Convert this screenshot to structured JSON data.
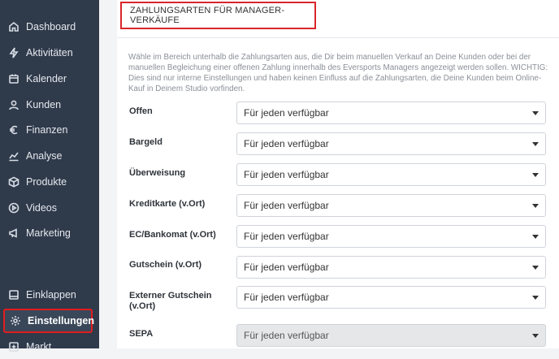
{
  "sidebar": {
    "items": [
      {
        "label": "Dashboard",
        "icon": "home-icon"
      },
      {
        "label": "Aktivitäten",
        "icon": "lightning-icon"
      },
      {
        "label": "Kalender",
        "icon": "calendar-icon"
      },
      {
        "label": "Kunden",
        "icon": "user-icon"
      },
      {
        "label": "Finanzen",
        "icon": "euro-icon"
      },
      {
        "label": "Analyse",
        "icon": "chart-line-icon"
      },
      {
        "label": "Produkte",
        "icon": "box-icon"
      },
      {
        "label": "Videos",
        "icon": "play-circle-icon"
      },
      {
        "label": "Marketing",
        "icon": "megaphone-icon"
      }
    ],
    "collapse_label": "Einklappen",
    "settings_label": "Einstellungen",
    "market_label": "Markt"
  },
  "panel": {
    "title": "ZAHLUNGSARTEN FÜR MANAGER-VERKÄUFE",
    "description": "Wähle im Bereich unterhalb die Zahlungsarten aus, die Dir beim manuellen Verkauf an Deine Kunden oder bei der manuellen Begleichung einer offenen Zahlung innerhalb des Eversports Managers angezeigt werden sollen. WICHTIG: Dies sind nur interne Einstellungen und haben keinen Einfluss auf die Zahlungsarten, die Deine Kunden beim Online-Kauf in Deinem Studio vorfinden.",
    "rows": [
      {
        "label": "Offen",
        "value": "Für jeden verfügbar"
      },
      {
        "label": "Bargeld",
        "value": "Für jeden verfügbar"
      },
      {
        "label": "Überweisung",
        "value": "Für jeden verfügbar"
      },
      {
        "label": "Kreditkarte (v.Ort)",
        "value": "Für jeden verfügbar"
      },
      {
        "label": "EC/Bankomat (v.Ort)",
        "value": "Für jeden verfügbar"
      },
      {
        "label": "Gutschein (v.Ort)",
        "value": "Für jeden verfügbar"
      },
      {
        "label": "Externer Gutschein (v.Ort)",
        "value": "Für jeden verfügbar"
      },
      {
        "label": "SEPA",
        "value": "Für jeden verfügbar"
      }
    ]
  },
  "colors": {
    "sidebar_bg": "#2f3a4b",
    "highlight": "#e01e1e"
  }
}
